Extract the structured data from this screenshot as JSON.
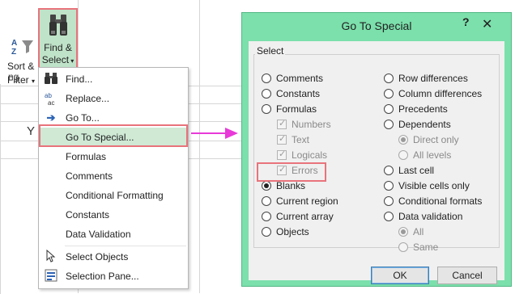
{
  "ribbon": {
    "sort_line1": "Sort &",
    "sort_line2": "Filter",
    "sort_icon": "sort-az-icon",
    "findselect_line1": "Find &",
    "findselect_line2": "Select",
    "findselect_icon": "binoculars-icon",
    "range_fragment": "ng",
    "cell_fragment": "Y"
  },
  "menu": {
    "items": [
      {
        "label": "Find...",
        "icon": "binoculars-icon"
      },
      {
        "label": "Replace...",
        "icon": "replace-icon"
      },
      {
        "label": "Go To...",
        "icon": "arrow-right-icon"
      },
      {
        "label": "Go To Special...",
        "icon": ""
      },
      {
        "label": "Formulas",
        "icon": ""
      },
      {
        "label": "Comments",
        "icon": ""
      },
      {
        "label": "Conditional Formatting",
        "icon": ""
      },
      {
        "label": "Constants",
        "icon": ""
      },
      {
        "label": "Data Validation",
        "icon": ""
      },
      {
        "label": "Select Objects",
        "icon": "cursor-icon"
      },
      {
        "label": "Selection Pane...",
        "icon": "selection-pane-icon"
      }
    ]
  },
  "dialog": {
    "title": "Go To Special",
    "help": "?",
    "close": "✕",
    "group_label": "Select",
    "left_options": {
      "comments": "Comments",
      "constants": "Constants",
      "formulas": "Formulas",
      "numbers": "Numbers",
      "text": "Text",
      "logicals": "Logicals",
      "errors": "Errors",
      "blanks": "Blanks",
      "current_region": "Current region",
      "current_array": "Current array",
      "objects": "Objects"
    },
    "right_options": {
      "row_differences": "Row differences",
      "column_differences": "Column differences",
      "precedents": "Precedents",
      "dependents": "Dependents",
      "direct_only": "Direct only",
      "all_levels": "All levels",
      "last_cell": "Last cell",
      "visible_cells_only": "Visible cells only",
      "conditional_formats": "Conditional formats",
      "data_validation": "Data validation",
      "all": "All",
      "same": "Same"
    },
    "selected": "Blanks",
    "ok_label": "OK",
    "cancel_label": "Cancel"
  },
  "colors": {
    "highlight_border": "#e8737b",
    "dialog_frame": "#7be0ab",
    "arrow": "#e83ad8",
    "menu_hover": "#cfe9d5"
  }
}
